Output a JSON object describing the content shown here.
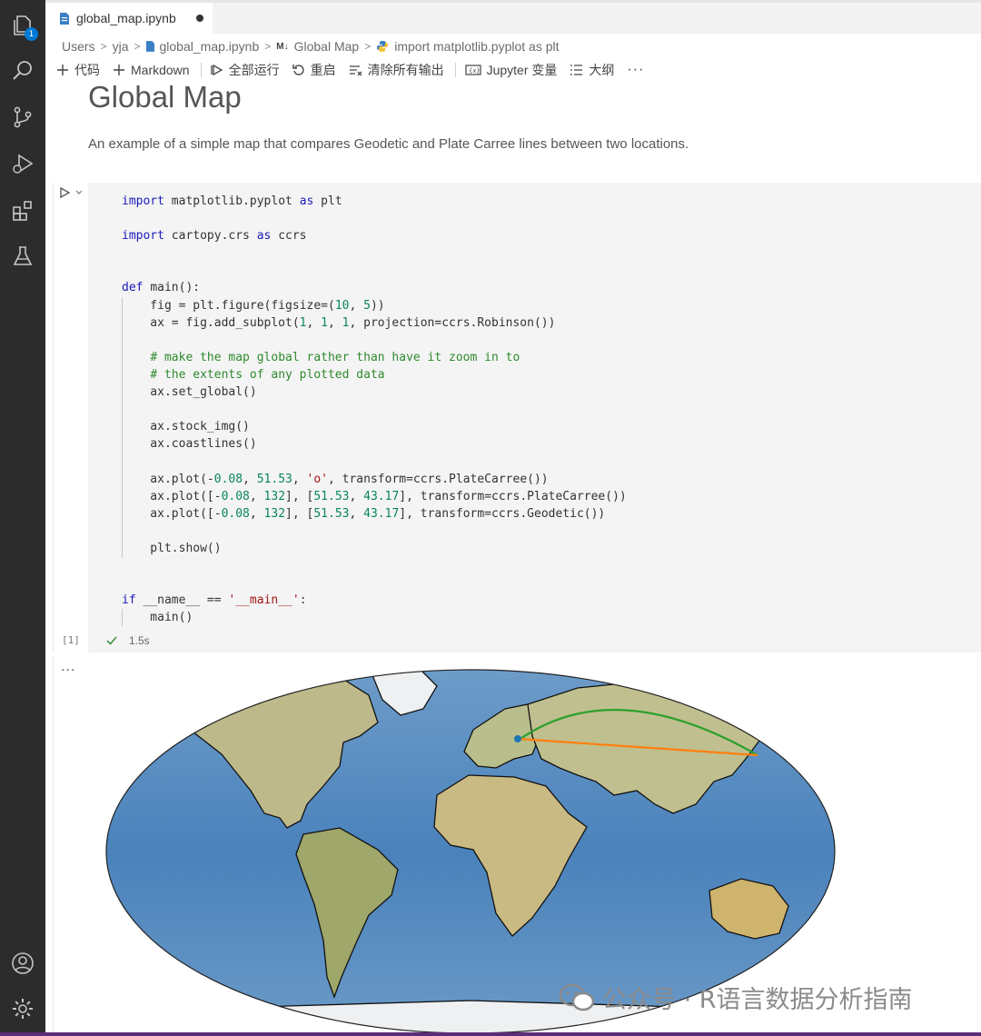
{
  "activity_bar": {
    "explorer_badge": "1",
    "icons": [
      "files-icon",
      "search-icon",
      "source-control-icon",
      "run-debug-icon",
      "extensions-icon",
      "testing-flask-icon",
      "account-icon",
      "settings-gear-icon"
    ]
  },
  "tab": {
    "filename": "global_map.ipynb"
  },
  "breadcrumb": {
    "items": [
      "Users",
      "yja",
      "global_map.ipynb",
      "Global Map",
      "import matplotlib.pyplot as plt"
    ],
    "markdown_badge": "M↓"
  },
  "toolbar": {
    "add_code": "代码",
    "add_markdown": "Markdown",
    "run_all": "全部运行",
    "restart": "重启",
    "clear_outputs": "清除所有输出",
    "jupyter_vars": "Jupyter 变量",
    "outline": "大纲",
    "more": "···"
  },
  "markdown": {
    "title": "Global Map",
    "text": "An example of a simple map that compares Geodetic and Plate Carree lines between two locations."
  },
  "cell": {
    "execution_count": "[1]",
    "duration": "1.5s"
  },
  "output": {
    "ellipsis": "..."
  },
  "watermark": {
    "text": "公众号 · R语言数据分析指南"
  },
  "colors": {
    "activity_bar": "#2c2c2c",
    "accent_badge": "#0078d4",
    "geodetic_line": "#2ca02c",
    "platecarree_line": "#ff7f0e",
    "ocean": "#4f86bd",
    "land": "#c7c38e"
  }
}
